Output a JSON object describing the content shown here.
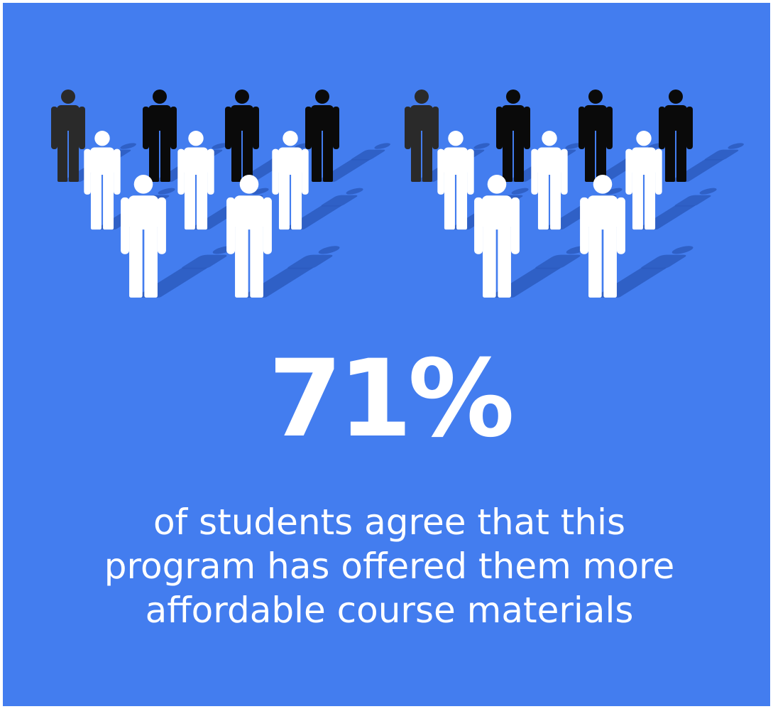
{
  "theme": {
    "background": "#437DEF",
    "shadow": "#2C5BBE",
    "figure_dark": "#2A2A2A",
    "figure_black": "#0A0A0A",
    "figure_light": "#FFFFFF"
  },
  "icons": {
    "figure": "person-icon"
  },
  "stat": {
    "value": "71%"
  },
  "caption": {
    "lines": [
      "of students agree that this",
      "program has offered them more",
      "affordable course materials"
    ]
  }
}
